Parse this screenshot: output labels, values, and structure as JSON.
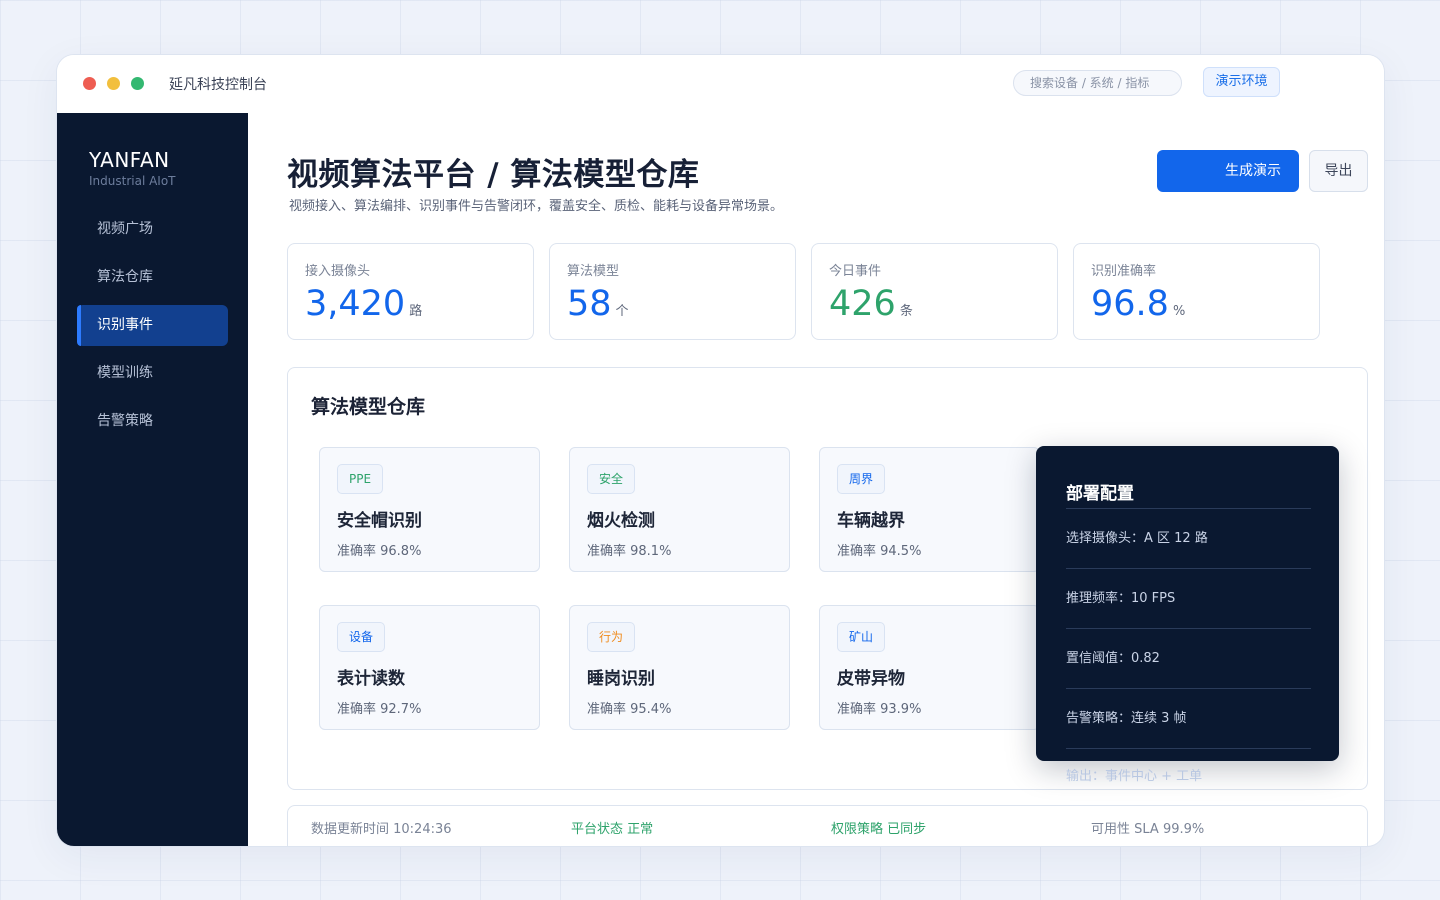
{
  "window": {
    "title": "延凡科技控制台"
  },
  "search": {
    "placeholder": "搜索设备 / 系统 / 指标"
  },
  "env_badge": "演示环境",
  "brand": {
    "name": "YANFAN",
    "subtitle": "Industrial AIoT"
  },
  "sidebar": {
    "items": [
      {
        "label": "视频广场",
        "active": false
      },
      {
        "label": "算法仓库",
        "active": false
      },
      {
        "label": "识别事件",
        "active": true
      },
      {
        "label": "模型训练",
        "active": false
      },
      {
        "label": "告警策略",
        "active": false
      }
    ]
  },
  "header": {
    "title": "视频算法平台 / 算法模型仓库",
    "subtitle": "视频接入、算法编排、识别事件与告警闭环，覆盖安全、质检、能耗与设备异常场景。",
    "primary_button": "生成演示",
    "secondary_button": "导出"
  },
  "stats": [
    {
      "label": "接入摄像头",
      "value": "3,420",
      "unit": "路",
      "color": "#1266eb"
    },
    {
      "label": "算法模型",
      "value": "58",
      "unit": "个",
      "color": "#1266eb"
    },
    {
      "label": "今日事件",
      "value": "426",
      "unit": "条",
      "color": "#2ea36b"
    },
    {
      "label": "识别准确率",
      "value": "96.8",
      "unit": "%",
      "color": "#1266eb"
    }
  ],
  "models": {
    "title": "算法模型仓库",
    "items": [
      {
        "tag": "PPE",
        "tag_color": "#2ea36b",
        "name": "安全帽识别",
        "accuracy": "准确率 96.8%"
      },
      {
        "tag": "安全",
        "tag_color": "#2ea36b",
        "name": "烟火检测",
        "accuracy": "准确率 98.1%"
      },
      {
        "tag": "周界",
        "tag_color": "#1266eb",
        "name": "车辆越界",
        "accuracy": "准确率 94.5%"
      },
      {
        "tag": "设备",
        "tag_color": "#1266eb",
        "name": "表计读数",
        "accuracy": "准确率 92.7%"
      },
      {
        "tag": "行为",
        "tag_color": "#f08c1f",
        "name": "睡岗识别",
        "accuracy": "准确率 95.4%"
      },
      {
        "tag": "矿山",
        "tag_color": "#1266eb",
        "name": "皮带异物",
        "accuracy": "准确率 93.9%"
      }
    ]
  },
  "deploy": {
    "title": "部署配置",
    "rows": [
      "选择摄像头：A 区 12 路",
      "推理频率：10 FPS",
      "置信阈值：0.82",
      "告警策略：连续 3 帧",
      "输出：事件中心 + 工单"
    ]
  },
  "statusbar": {
    "updated": "数据更新时间 10:24:36",
    "platform": "平台状态 正常",
    "permission": "权限策略 已同步",
    "sla": "可用性 SLA 99.9%"
  }
}
